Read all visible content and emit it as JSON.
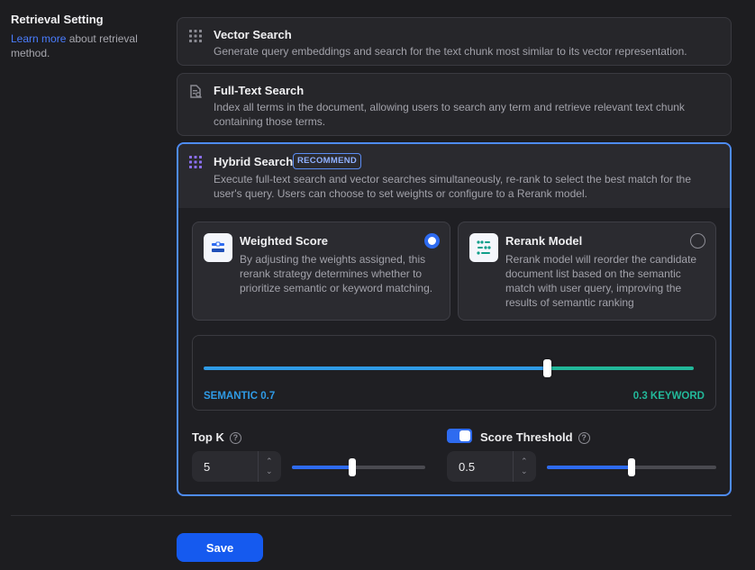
{
  "left": {
    "title": "Retrieval Setting",
    "link": "Learn more",
    "desc": " about retrieval method."
  },
  "options": {
    "vector": {
      "title": "Vector Search",
      "desc": "Generate query embeddings and search for the text chunk most similar to its vector representation."
    },
    "fulltext": {
      "title": "Full-Text Search",
      "desc": "Index all terms in the document, allowing users to search any term and retrieve relevant text chunk containing those terms."
    },
    "hybrid": {
      "title": "Hybrid Search",
      "badge": "RECOMMEND",
      "desc": "Execute full-text search and vector searches simultaneously, re-rank to select the best match for the user's query. Users can choose to set weights or configure to a Rerank model."
    }
  },
  "rerank_modes": {
    "weighted": {
      "title": "Weighted Score",
      "desc": "By adjusting the weights assigned, this rerank strategy determines whether to prioritize semantic or keyword matching.",
      "selected": true
    },
    "model": {
      "title": "Rerank Model",
      "desc": "Rerank model will reorder the candidate document list based on the semantic match with user query, improving the results of semantic ranking",
      "selected": false
    }
  },
  "weights": {
    "semantic_label": "SEMANTIC 0.7",
    "keyword_label": "0.3 KEYWORD",
    "semantic_value": 0.7,
    "semantic_color": "#2f9be6",
    "keyword_color": "#22b89a"
  },
  "top_k": {
    "label": "Top K",
    "help": "?",
    "value": "5",
    "slider_fraction": 0.45
  },
  "score_threshold": {
    "label": "Score Threshold",
    "help": "?",
    "enabled": true,
    "value": "0.5",
    "slider_fraction": 0.5
  },
  "save_label": "Save",
  "colors": {
    "accent": "#155aef",
    "selected_border": "#4e8cf5"
  }
}
